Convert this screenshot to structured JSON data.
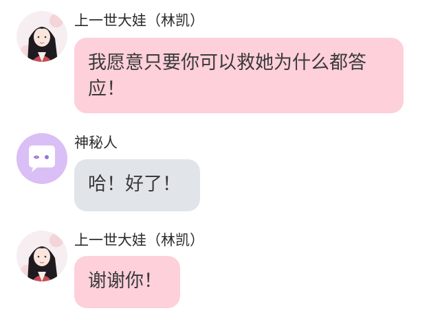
{
  "colors": {
    "pink_bubble": "#fdd0da",
    "gray_bubble": "#e1e5ea",
    "mystery_avatar_bg": "#d9bff5",
    "mystery_icon_accent": "#9a72d8"
  },
  "messages": [
    {
      "sender": "上一世大娃（林凯）",
      "avatar_icon": "anime-portrait-avatar",
      "text": "我愿意只要你可以救她为什么都答应！"
    },
    {
      "sender": "神秘人",
      "avatar_icon": "chat-bubble-avatar",
      "text": "哈！好了！"
    },
    {
      "sender": "上一世大娃（林凯）",
      "avatar_icon": "anime-portrait-avatar",
      "text": "谢谢你！"
    }
  ]
}
